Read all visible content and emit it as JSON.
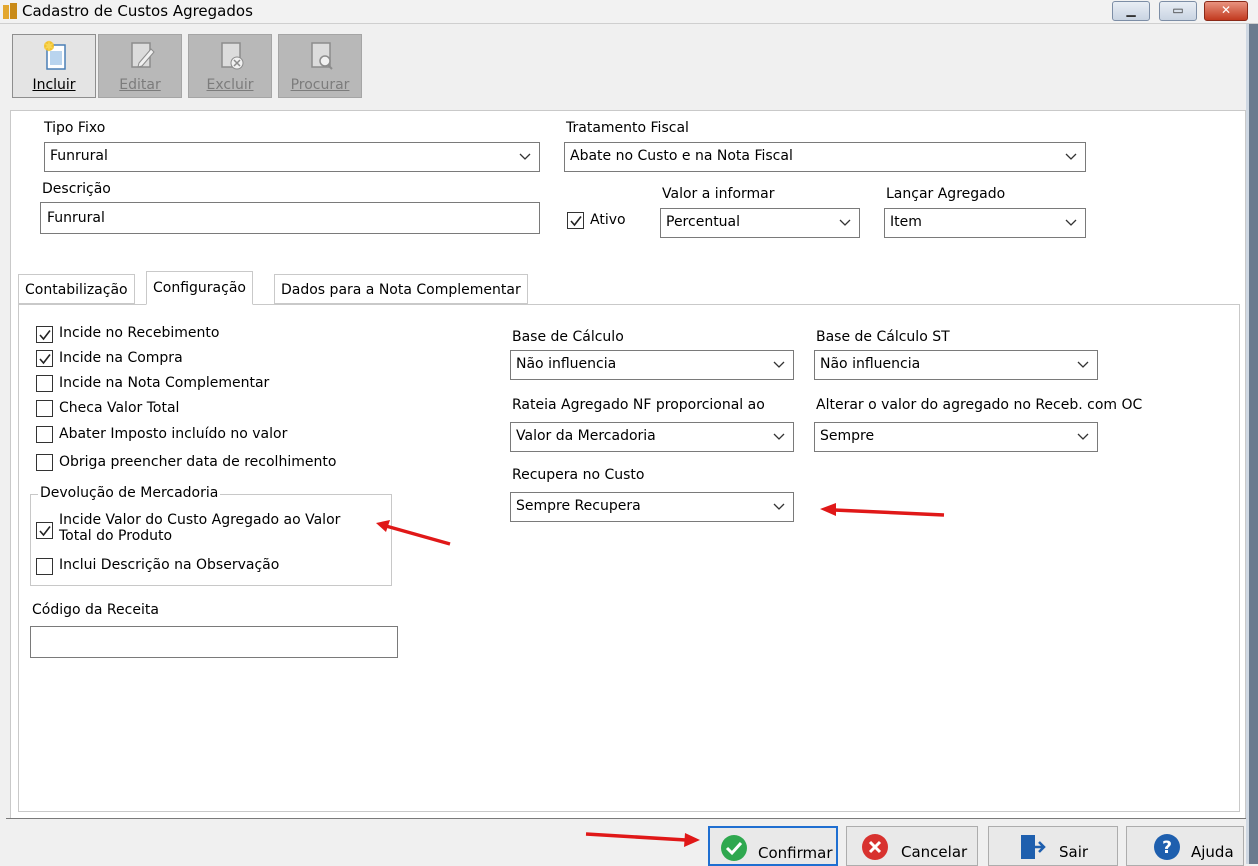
{
  "window": {
    "title": "Cadastro de Custos Agregados"
  },
  "toolbar": {
    "incluir": "Incluir",
    "editar": "Editar",
    "excluir": "Excluir",
    "procurar": "Procurar"
  },
  "form": {
    "tipo_fixo_label": "Tipo Fixo",
    "tipo_fixo_value": "Funrural",
    "tratamento_label": "Tratamento Fiscal",
    "tratamento_value": "Abate no Custo e na Nota Fiscal",
    "descricao_label": "Descrição",
    "descricao_value": "Funrural",
    "ativo_label": "Ativo",
    "ativo_checked": true,
    "valor_informar_label": "Valor a informar",
    "valor_informar_value": "Percentual",
    "lancar_label": "Lançar Agregado",
    "lancar_value": "Item"
  },
  "tabs": [
    {
      "label": "Contabilização"
    },
    {
      "label": "Configuração",
      "selected": true
    },
    {
      "label": "Dados para a Nota Complementar"
    }
  ],
  "config": {
    "checks": [
      {
        "label": "Incide no Recebimento",
        "checked": true
      },
      {
        "label": "Incide na Compra",
        "checked": true
      },
      {
        "label": "Incide na Nota Complementar",
        "checked": false
      },
      {
        "label": "Checa Valor Total",
        "checked": false
      },
      {
        "label": "Abater Imposto incluído no valor",
        "checked": false
      },
      {
        "label": "Obriga preencher data de recolhimento",
        "checked": false
      }
    ],
    "devolucao_title": "Devolução de Mercadoria",
    "devolucao_check1_line1": "Incide Valor do Custo Agregado ao Valor",
    "devolucao_check1_line2": "Total do Produto",
    "devolucao_check1_checked": true,
    "devolucao_check2": "Inclui Descrição na Observação",
    "devolucao_check2_checked": false,
    "codigo_receita_label": "Código da Receita",
    "codigo_receita_value": "",
    "base_calculo_label": "Base de Cálculo",
    "base_calculo_value": "Não influencia",
    "base_calculo_st_label": "Base de Cálculo ST",
    "base_calculo_st_value": "Não influencia",
    "rateia_label": "Rateia Agregado NF proporcional ao",
    "rateia_value": "Valor da Mercadoria",
    "alterar_label": "Alterar o valor do agregado no Receb. com OC",
    "alterar_value": "Sempre",
    "recupera_label": "Recupera no Custo",
    "recupera_value": "Sempre Recupera"
  },
  "bottom": {
    "confirmar": "Confirmar",
    "cancelar": "Cancelar",
    "sair": "Sair",
    "ajuda": "Ajuda"
  },
  "colors": {
    "accent_focus": "#1f6fd1",
    "arrow_red": "#e01818",
    "confirm_green": "#2fa84f",
    "cancel_red": "#d8322f",
    "help_blue": "#1e5fae"
  }
}
